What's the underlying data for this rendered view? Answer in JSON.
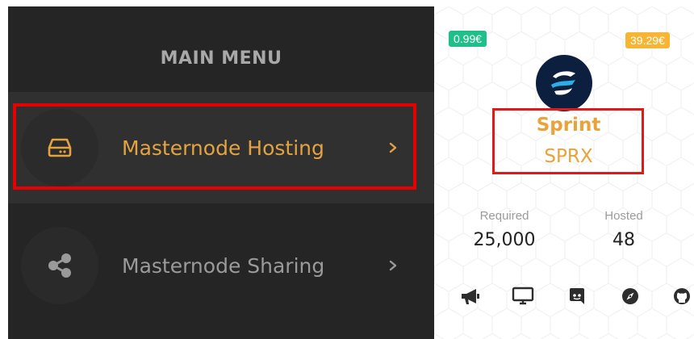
{
  "sidebar": {
    "heading": "MAIN MENU",
    "items": [
      {
        "label": "Masternode Hosting",
        "icon": "server-icon",
        "active": true
      },
      {
        "label": "Masternode Sharing",
        "icon": "share-icon",
        "active": false
      }
    ]
  },
  "coin": {
    "price_low": "0.99€",
    "price_high": "39.29€",
    "name": "Sprint",
    "ticker": "SPRX",
    "required_label": "Required",
    "required_value": "25,000",
    "hosted_label": "Hosted",
    "hosted_value": "48",
    "social_icons": [
      "megaphone-icon",
      "monitor-icon",
      "discord-icon",
      "explorer-icon",
      "github-icon"
    ]
  },
  "colors": {
    "sidebar_bg": "#252525",
    "active_accent": "#e3a341",
    "highlight_red": "#e60000",
    "badge_green": "#1fbf8a",
    "badge_orange": "#f8b534"
  }
}
